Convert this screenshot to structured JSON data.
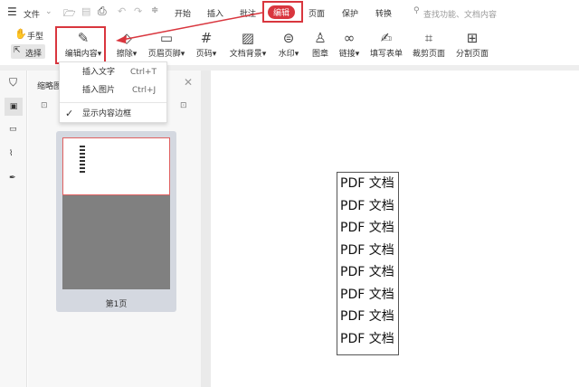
{
  "menubar": {
    "file": "文件",
    "tabs": [
      "开始",
      "插入",
      "批注",
      "编辑",
      "页面",
      "保护",
      "转换"
    ],
    "active_tab": "编辑",
    "search_placeholder": "查找功能、文档内容"
  },
  "ribbon": {
    "hand": "手型",
    "select": "选择",
    "items": [
      "编辑内容",
      "擦除",
      "页眉页脚",
      "页码",
      "文档背景",
      "水印",
      "图章",
      "链接",
      "填写表单",
      "裁剪页面",
      "分割页面"
    ]
  },
  "dropdown": {
    "items": [
      {
        "label": "插入文字",
        "shortcut": "Ctrl+T"
      },
      {
        "label": "插入图片",
        "shortcut": "Ctrl+J"
      }
    ],
    "toggle": "显示内容边框"
  },
  "panel": {
    "title": "缩略图",
    "page_label": "第1页"
  },
  "document": {
    "lines": [
      "PDF 文档",
      "PDF 文档",
      "PDF 文档",
      "PDF 文档",
      "PDF 文档",
      "PDF 文档",
      "PDF 文档",
      "PDF 文档"
    ]
  },
  "colors": {
    "accent": "#d9363e"
  }
}
